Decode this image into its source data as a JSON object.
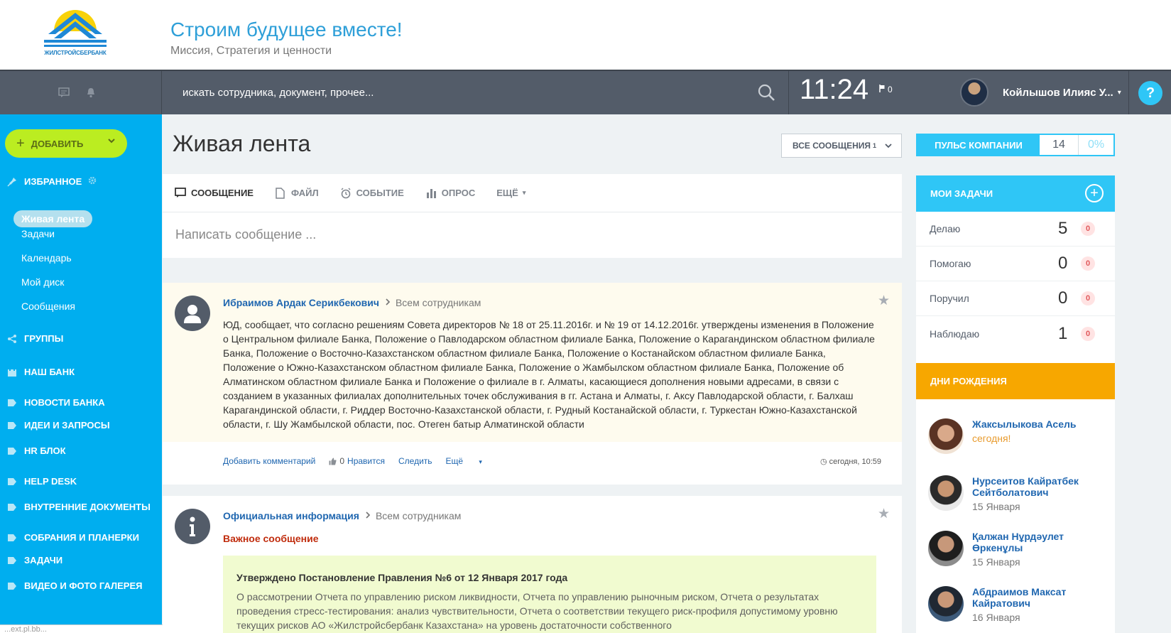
{
  "header": {
    "logo_text": "ЖИЛСТРОЙСБЕРБАНК",
    "title": "Строим будущее вместе!",
    "subtitle": "Миссия, Стратегия и ценности"
  },
  "topbar": {
    "search_placeholder": "искать сотрудника, документ, прочее...",
    "time": "11:24",
    "flag_count": "0",
    "user_name": "Койлышов Илияс У...",
    "help": "?"
  },
  "sidebar": {
    "add_label": "Добавить",
    "favorites_label": "Избранное",
    "active_item": "Живая лента",
    "items": [
      "Задачи",
      "Календарь",
      "Мой диск",
      "Сообщения"
    ],
    "sections": [
      "Группы",
      "Наш банк",
      "Новости банка",
      "Идеи и запросы",
      "HR блок",
      "Help Desk",
      "Внутренние документы",
      "Собрания и планерки",
      "Задачи",
      "Видео и фото галерея"
    ],
    "bottom_hint": "...ext.pl.bb..."
  },
  "feed": {
    "title": "Живая лента",
    "filter_label": "Все сообщения",
    "filter_count": "1",
    "composer_tabs": [
      "Сообщение",
      "Файл",
      "Событие",
      "Опрос",
      "Ещё"
    ],
    "composer_placeholder": "Написать сообщение ...",
    "posts": [
      {
        "author": "Ибраимов Ардак Серикбекович",
        "destination": "Всем сотрудникам",
        "text": "ЮД, сообщает, что согласно решениям Совета директоров № 18 от 25.11.2016г. и № 19 от 14.12.2016г. утверждены изменения в Положение о Центральном филиале Банка, Положение о Павлодарском областном филиале Банка, Положение о Карагандинском областном филиале Банка, Положение о Восточно-Казахстанском областном филиале Банка, Положение о Костанайском областном филиале Банка, Положение о Южно-Казахстанском областном филиале Банка, Положение о Жамбылском областном филиале Банка, Положение об Алматинском областном филиале Банка и Положение о филиале в г. Алматы, касающиеся дополнения новыми адресами, в связи с созданием в указанных филиалах дополнительных точек обслуживания в гг. Астана и Алматы, г. Аксу Павлодарской области, г. Балхаш Карагандинской области, г. Риддер Восточно-Казахстанской области, г. Рудный Костанайской области, г. Туркестан Южно-Казахстанской области, г. Шу Жамбылской области, пос. Отеген батыр Алматинской области",
        "add_comment": "Добавить комментарий",
        "likes": "0",
        "like_label": "Нравится",
        "follow": "Следить",
        "more": "Ещё",
        "time": "сегодня, 10:59"
      },
      {
        "author": "Официальная информация",
        "destination": "Всем сотрудникам",
        "important_label": "Важное сообщение",
        "important_title": "Утверждено Постановление Правления №6 от 12 Января 2017 года",
        "important_text": "О рассмотрении Отчета по управлению риском ликвидности, Отчета по управлению рыночным риском, Отчета о результатах проведения стресс-тестирования: анализ чувствительности, Отчета о соответствии текущего риск-профиля допустимому уровню текущих рисков АО «Жилстройсбербанк Казахстана» на уровень достаточности собственного"
      }
    ]
  },
  "pulse": {
    "label": "Пульс компании",
    "count": "14",
    "percent": "0%"
  },
  "tasks": {
    "title": "Мои задачи",
    "rows": [
      {
        "label": "Делаю",
        "count": "5",
        "badge": "0"
      },
      {
        "label": "Помогаю",
        "count": "0",
        "badge": "0"
      },
      {
        "label": "Поручил",
        "count": "0",
        "badge": "0"
      },
      {
        "label": "Наблюдаю",
        "count": "1",
        "badge": "0"
      }
    ]
  },
  "birthdays": {
    "title": "Дни рождения",
    "people": [
      {
        "name": "Жаксылыкова Асель",
        "date": "сегодня!"
      },
      {
        "name": "Нурсеитов Кайратбек Сейтболатович",
        "date": "15 Января"
      },
      {
        "name": "Қалжан Нұрдәулет Өркенұлы",
        "date": "15 Января"
      },
      {
        "name": "Абдраимов Максат Кайратович",
        "date": "16 Января"
      }
    ]
  },
  "colors": {
    "sidebar": "#00aeef",
    "add_button": "#bbed21",
    "topbar": "#535c69",
    "accent_blue": "#2fc6f6",
    "birthday_header": "#f7a700",
    "link": "#2067b0",
    "important": "#c02c0d"
  },
  "icons": [
    "chat-icon",
    "bell-icon",
    "search-icon",
    "flag-icon",
    "caret-down-icon",
    "plus-icon",
    "chevron-down-icon",
    "pin-icon",
    "gear-icon",
    "share-icon",
    "castle-icon",
    "tag-icon",
    "message-icon",
    "file-icon",
    "alarm-icon",
    "bar-chart-icon",
    "user-icon",
    "info-icon",
    "star-icon",
    "thumbs-up-icon",
    "clock-icon",
    "plus-circle-icon"
  ]
}
